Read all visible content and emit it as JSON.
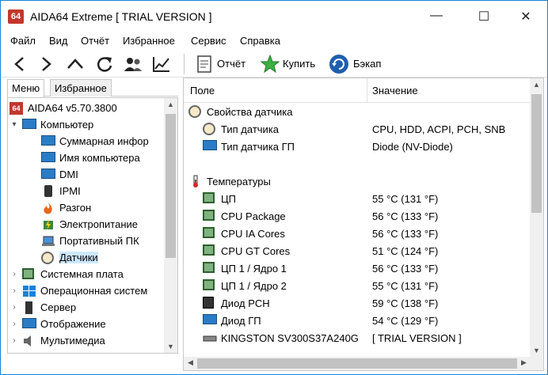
{
  "window": {
    "app_icon_text": "64",
    "title": "AIDA64 Extreme  [ TRIAL VERSION ]",
    "minimize": "—",
    "maximize": "☐",
    "close": "✕"
  },
  "menu": [
    "Файл",
    "Вид",
    "Отчёт",
    "Избранное",
    "Сервис",
    "Справка"
  ],
  "toolbar": {
    "report": "Отчёт",
    "buy": "Купить",
    "backup": "Бэкап"
  },
  "tabs": [
    "Меню",
    "Избранное"
  ],
  "tree": [
    {
      "label": "AIDA64 v5.70.3800",
      "icon": "aida-icon",
      "exp": ""
    },
    {
      "label": "Компьютер",
      "icon": "computer-icon",
      "exp": "▾"
    },
    {
      "label": "Суммарная инфор",
      "icon": "computer-icon",
      "exp": ""
    },
    {
      "label": "Имя компьютера",
      "icon": "computer-icon",
      "exp": ""
    },
    {
      "label": "DMI",
      "icon": "computer-icon",
      "exp": ""
    },
    {
      "label": "IPMI",
      "icon": "ipmi-icon",
      "exp": ""
    },
    {
      "label": "Разгон",
      "icon": "flame-icon",
      "exp": ""
    },
    {
      "label": "Электропитание",
      "icon": "power-icon",
      "exp": ""
    },
    {
      "label": "Портативный ПК",
      "icon": "laptop-icon",
      "exp": ""
    },
    {
      "label": "Датчики",
      "icon": "sensor-icon",
      "exp": ""
    },
    {
      "label": "Системная плата",
      "icon": "motherboard-icon",
      "exp": "›"
    },
    {
      "label": "Операционная систем",
      "icon": "windows-icon",
      "exp": "›"
    },
    {
      "label": "Сервер",
      "icon": "server-icon",
      "exp": "›"
    },
    {
      "label": "Отображение",
      "icon": "display-icon",
      "exp": "›"
    },
    {
      "label": "Мультимедиа",
      "icon": "speaker-icon",
      "exp": "›"
    }
  ],
  "columns": {
    "field": "Поле",
    "value": "Значение"
  },
  "rows": [
    {
      "type": "group",
      "field": "Свойства датчика",
      "value": "",
      "icon": "sensor-icon"
    },
    {
      "type": "item",
      "field": "Тип датчика",
      "value": "CPU, HDD, ACPI, PCH, SNB",
      "icon": "sensor-icon"
    },
    {
      "type": "item",
      "field": "Тип датчика ГП",
      "value": "Diode  (NV-Diode)",
      "icon": "gpu-icon"
    },
    {
      "type": "blank",
      "field": "",
      "value": "",
      "icon": ""
    },
    {
      "type": "group",
      "field": "Температуры",
      "value": "",
      "icon": "thermometer-icon"
    },
    {
      "type": "item",
      "field": "ЦП",
      "value": "55 °C  (131 °F)",
      "icon": "chip-icon"
    },
    {
      "type": "item",
      "field": "CPU Package",
      "value": "56 °C  (133 °F)",
      "icon": "chip-icon"
    },
    {
      "type": "item",
      "field": "CPU IA Cores",
      "value": "56 °C  (133 °F)",
      "icon": "chip-icon"
    },
    {
      "type": "item",
      "field": "CPU GT Cores",
      "value": "51 °C  (124 °F)",
      "icon": "chip-icon"
    },
    {
      "type": "item",
      "field": "ЦП 1 / Ядро 1",
      "value": "56 °C  (133 °F)",
      "icon": "chip-icon"
    },
    {
      "type": "item",
      "field": "ЦП 1 / Ядро 2",
      "value": "55 °C  (131 °F)",
      "icon": "chip-icon"
    },
    {
      "type": "item",
      "field": "Диод PCH",
      "value": "59 °C  (138 °F)",
      "icon": "pch-icon"
    },
    {
      "type": "item",
      "field": "Диод ГП",
      "value": "54 °C  (129 °F)",
      "icon": "gpu-icon"
    },
    {
      "type": "item",
      "field": "KINGSTON SV300S37A240G",
      "value": "[ TRIAL VERSION ]",
      "icon": "disk-icon"
    }
  ],
  "colors": {
    "accent": "#1883d7",
    "selection": "#cde8ff",
    "chip": "#2e5e2e"
  }
}
